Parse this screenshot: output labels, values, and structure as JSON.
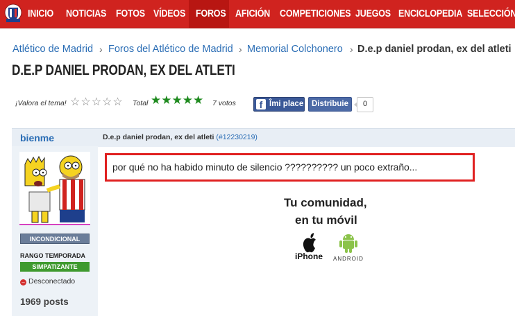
{
  "nav": {
    "logo_icon": "club-crest-icon",
    "items": [
      "INICIO",
      "NOTICIAS",
      "FOTOS",
      "VÍDEOS",
      "FOROS",
      "AFICIÓN",
      "COMPETICIONES",
      "JUEGOS",
      "ENCICLOPEDIA",
      "SELECCIÓN"
    ],
    "active": "FOROS",
    "colors": {
      "bar": "#d0231f",
      "active": "#b81612"
    }
  },
  "breadcrumb": [
    "Atlético de Madrid",
    "Foros del Atlético de Madrid",
    "Memorial Colchonero",
    "D.e.p daniel prodan, ex del atleti"
  ],
  "thread": {
    "title": "D.E.P DANIEL PRODAN, EX DEL ATLETI"
  },
  "rating": {
    "prompt": "¡Valora el tema!",
    "total_label": "Total",
    "stars_total": 5,
    "stars_filled": 5,
    "votes": "7 votos"
  },
  "share": {
    "like_label": "Îmi place",
    "share_label": "Distribuie",
    "count": "0"
  },
  "post": {
    "username": "bienme",
    "subject": "D.e.p daniel prodan, ex del atleti",
    "post_id": "(#12230219)",
    "badge": "INCONDICIONAL",
    "rank_label": "RANGO TEMPORADA",
    "rank": "SIMPATIZANTE",
    "status": "Desconectado",
    "post_count": "1969 posts",
    "message": "por qué no ha habido minuto de silencio ?????????? un poco extraño..."
  },
  "promo": {
    "line1": "Tu comunidad,",
    "line2": "en tu móvil",
    "iphone_label": "iPhone",
    "android_label": "ANDROID"
  }
}
